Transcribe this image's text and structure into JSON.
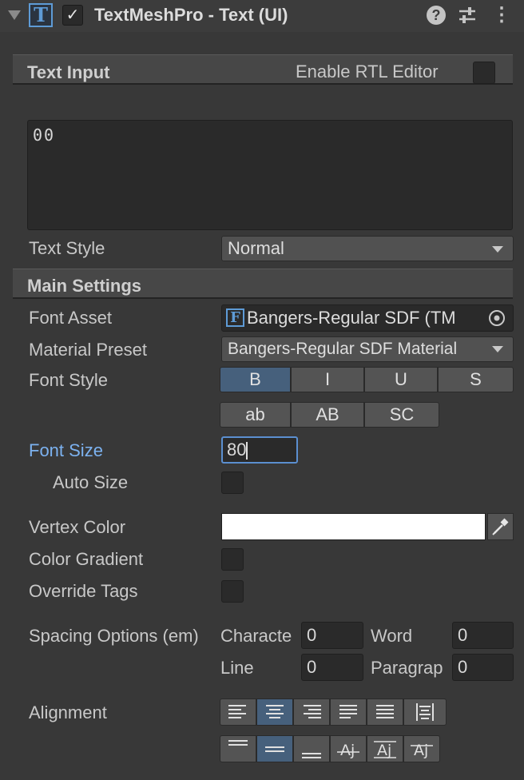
{
  "header": {
    "title": "TextMeshPro - Text (UI)",
    "component_icon_letter": "T",
    "enabled_glyph": "✓",
    "help_glyph": "?",
    "kebab_glyph": "⋮"
  },
  "text_input": {
    "section_label": "Text Input",
    "rtl_label": "Enable RTL Editor",
    "text_value": "00",
    "text_style_label": "Text Style",
    "text_style_value": "Normal"
  },
  "main_settings": {
    "section_label": "Main Settings",
    "font_asset_label": "Font Asset",
    "font_asset_icon_letter": "F",
    "font_asset_value": "Bangers-Regular SDF (TM",
    "material_preset_label": "Material Preset",
    "material_preset_value": "Bangers-Regular SDF Material",
    "font_style_label": "Font Style",
    "font_style_buttons": [
      "B",
      "I",
      "U",
      "S"
    ],
    "case_buttons": [
      "ab",
      "AB",
      "SC"
    ],
    "font_size_label": "Font Size",
    "font_size_value": "80",
    "auto_size_label": "Auto Size",
    "vertex_color_label": "Vertex Color",
    "vertex_color": "#ffffff",
    "color_gradient_label": "Color Gradient",
    "override_tags_label": "Override Tags",
    "spacing_label": "Spacing Options (em)",
    "character_label": "Characte",
    "character_value": "0",
    "word_label": "Word",
    "word_value": "0",
    "line_label": "Line",
    "line_value": "0",
    "paragraph_label": "Paragrap",
    "paragraph_value": "0",
    "alignment_label": "Alignment",
    "horizontal_alignment_selected": "center",
    "vertical_alignment_selected": "middle"
  },
  "colors": {
    "accent_blue": "#5b8fd0",
    "selected_button": "#46607c",
    "font_size_label_color": "#7cb2f0"
  }
}
